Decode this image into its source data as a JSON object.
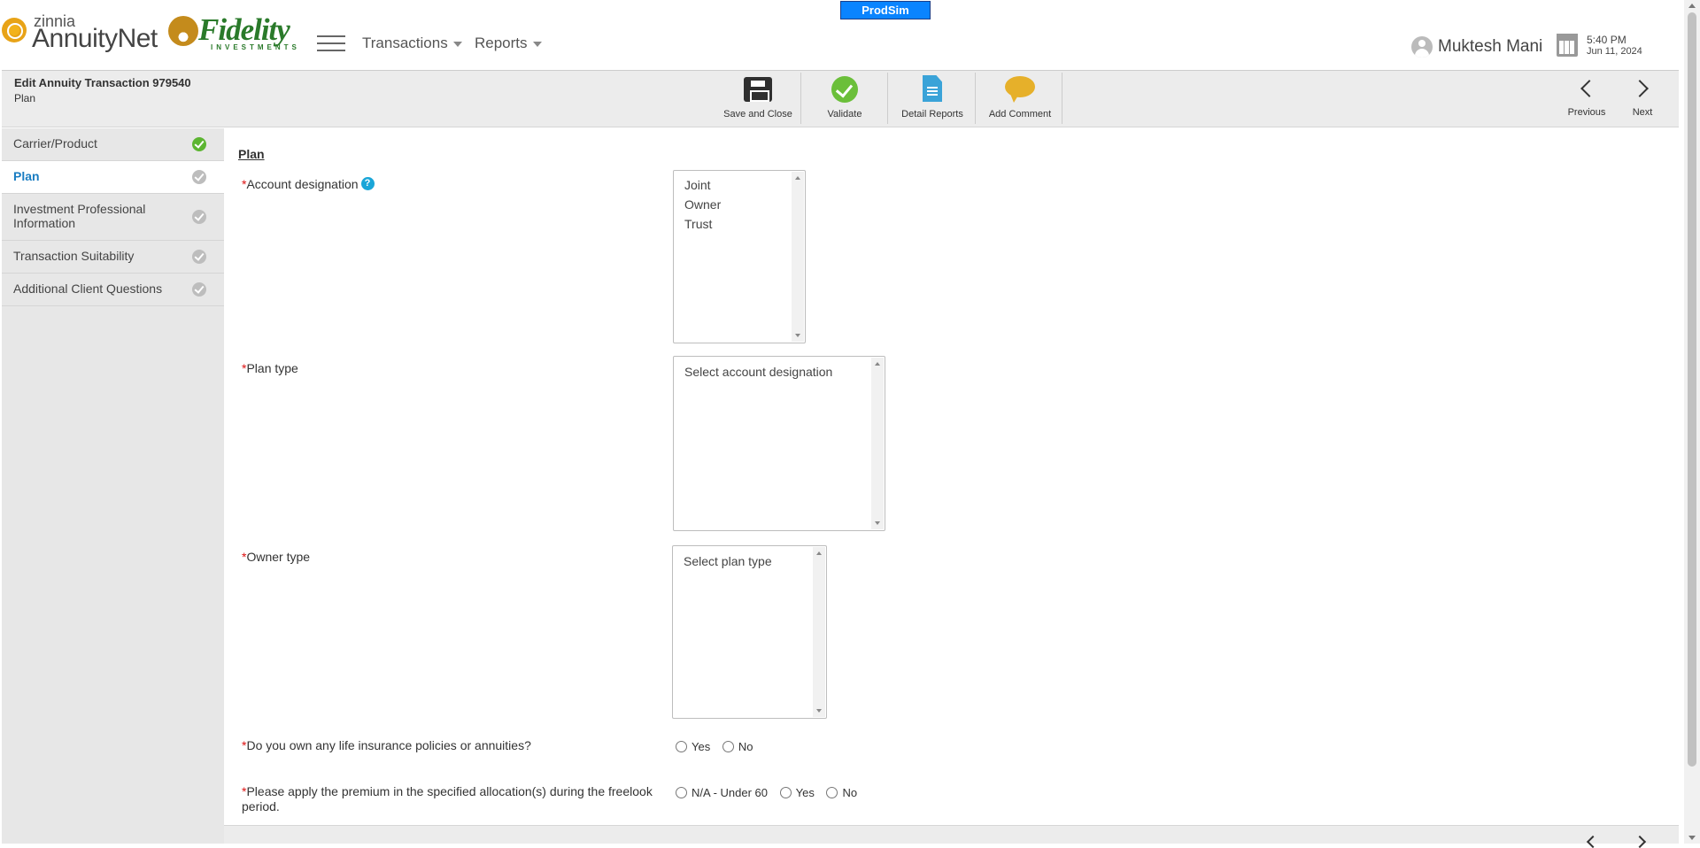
{
  "env_badge": "ProdSim",
  "logos": {
    "zinnia_small": "zinnia",
    "zinnia_big": "AnnuityNet",
    "fidelity_word": "Fidelity",
    "fidelity_sub": "INVESTMENTS"
  },
  "nav": {
    "transactions": "Transactions",
    "reports": "Reports"
  },
  "user": {
    "name": "Muktesh Mani"
  },
  "clock": {
    "time": "5:40 PM",
    "date": "Jun 11, 2024"
  },
  "toolbar": {
    "title": "Edit Annuity Transaction 979540",
    "subtitle": "Plan",
    "save_label": "Save and Close",
    "validate_label": "Validate",
    "detail_reports_label": "Detail Reports",
    "add_comment_label": "Add Comment",
    "previous_label": "Previous",
    "next_label": "Next"
  },
  "sidebar": {
    "items": [
      {
        "label": "Carrier/Product",
        "status": "complete"
      },
      {
        "label": "Plan",
        "status": "active"
      },
      {
        "label": "Investment Professional Information",
        "status": "pending"
      },
      {
        "label": "Transaction Suitability",
        "status": "pending"
      },
      {
        "label": "Additional Client Questions",
        "status": "pending"
      }
    ]
  },
  "main": {
    "section_title": "Plan",
    "required_mark": "*",
    "fields": {
      "account_designation": {
        "label": "Account designation",
        "help": "?",
        "options": [
          "Joint",
          "Owner",
          "Trust"
        ]
      },
      "plan_type": {
        "label": "Plan type",
        "options": [
          "Select account designation"
        ]
      },
      "owner_type": {
        "label": "Owner type",
        "options": [
          "Select plan type"
        ]
      },
      "life_insurance": {
        "label": "Do you own any life insurance policies or annuities?",
        "options": [
          "Yes",
          "No"
        ]
      },
      "freelook": {
        "label": "Please apply the premium in the specified allocation(s) during the freelook period.",
        "options": [
          "N/A - Under 60",
          "Yes",
          "No"
        ]
      }
    }
  },
  "colors": {
    "badge": "#0a84ff",
    "active_link": "#1a7dc2",
    "check_done": "#5cb531",
    "required": "#dd1111"
  }
}
